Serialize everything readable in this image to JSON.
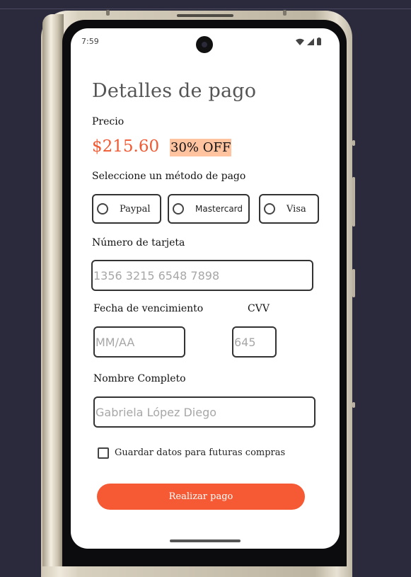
{
  "status_bar": {
    "time": "7:59"
  },
  "title": "Detalles de pago",
  "price_label": "Precio",
  "price": "$215.60",
  "discount": "30% OFF",
  "payment_method_label": "Seleccione un método de pago",
  "payment_methods": [
    "Paypal",
    "Mastercard",
    "Visa"
  ],
  "card_number": {
    "label": "Número de tarjeta",
    "placeholder": "1356 3215 6548 7898",
    "value": ""
  },
  "expiry": {
    "label": "Fecha de vencimiento",
    "placeholder": "MM/AA",
    "value": ""
  },
  "cvv": {
    "label": "CVV",
    "placeholder": "645",
    "value": ""
  },
  "full_name": {
    "label": "Nombre Completo",
    "placeholder": "Gabriela López Diego",
    "value": ""
  },
  "save_data_label": "Guardar datos para futuras compras",
  "submit_label": "Realizar pago",
  "colors": {
    "accent": "#f65a34",
    "discount_bg": "#ffc3a0",
    "background": "#2b2a3c"
  }
}
